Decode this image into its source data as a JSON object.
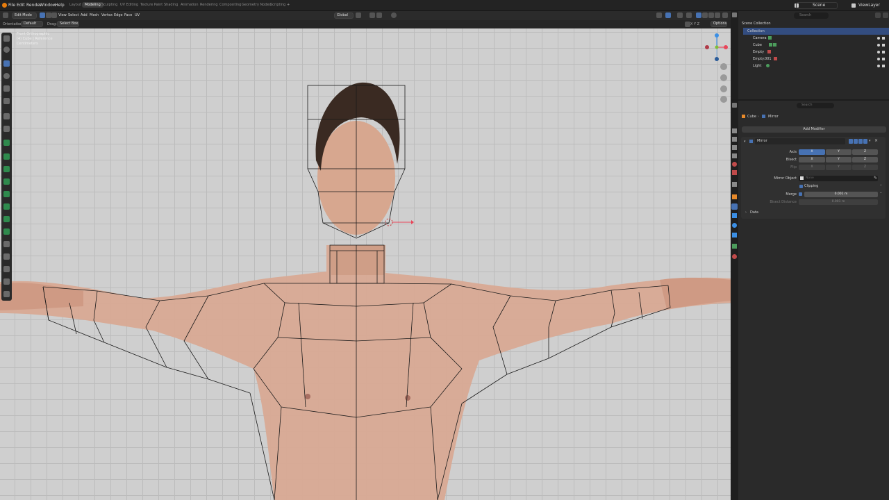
{
  "menus": [
    "File",
    "Edit",
    "Render",
    "Window",
    "Help"
  ],
  "workspaces": [
    "Layout",
    "Modeling",
    "Sculpting",
    "UV Editing",
    "Texture Paint",
    "Shading",
    "Animation",
    "Rendering",
    "Compositing",
    "Geometry Nodes",
    "Scripting"
  ],
  "active_workspace": "Modeling",
  "scene": {
    "name": "Scene",
    "view_layer": "ViewLayer"
  },
  "header": {
    "mode": "Edit Mode",
    "menus": [
      "View",
      "Select",
      "Add",
      "Mesh",
      "Vertex",
      "Edge",
      "Face",
      "UV"
    ],
    "transform": "Global",
    "orientation_label": "Orientation:",
    "orientation": "Default",
    "drag_label": "Drag:",
    "drag": "Select Box",
    "options": "Options",
    "xyz": "X Y Z"
  },
  "viewport": {
    "info_lines": [
      "Front Orthographic",
      "(4) Cube | Reference",
      "Centimeters"
    ]
  },
  "outliner": {
    "search_placeholder": "Search",
    "root": "Scene Collection",
    "collection": "Collection",
    "items": [
      "Camera",
      "Cube",
      "Empty",
      "Empty.001",
      "Light"
    ]
  },
  "properties": {
    "search_placeholder": "Search",
    "breadcrumb_object": "Cube",
    "breadcrumb_modifier": "Mirror",
    "add_modifier": "Add Modifier",
    "modifier_name": "Mirror",
    "axis_label": "Axis",
    "bisect_label": "Bisect",
    "flip_label": "Flip",
    "axes": [
      "X",
      "Y",
      "Z"
    ],
    "axis_selected": "X",
    "mirror_object_label": "Mirror Object",
    "mirror_object_value": "None",
    "clipping_label": "Clipping",
    "merge_label": "Merge",
    "merge_value": "0.001 m",
    "bisect_distance_label": "Bisect Distance",
    "bisect_distance_value": "0.001 m",
    "data_label": "Data"
  },
  "colors": {
    "accent": "#4772b3",
    "viewport_bg": "#cfcfcf",
    "panel": "#2a2a2a",
    "gizmo_x": "#e8465a",
    "gizmo_y": "#7dbf39",
    "gizmo_z": "#3b8fe5"
  }
}
